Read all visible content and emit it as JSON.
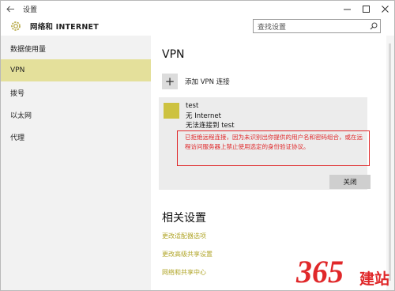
{
  "window": {
    "title": "设置"
  },
  "header": {
    "app_title": "网络和 INTERNET",
    "search_placeholder": "查找设置"
  },
  "sidebar": {
    "items": [
      {
        "label": "数据使用量"
      },
      {
        "label": "VPN"
      },
      {
        "label": "拨号"
      },
      {
        "label": "以太网"
      },
      {
        "label": "代理"
      }
    ],
    "active_index": 1
  },
  "main": {
    "heading": "VPN",
    "add_label": "添加 VPN 连接",
    "connection": {
      "name": "test",
      "status_line1": "无 Internet",
      "status_line2": "无法连接到 test",
      "error_message": "已拒绝远程连接，因为未识别出你提供的用户名和密码组合，或在远程访问服务器上禁止使用选定的身份验证协议。",
      "close_label": "关闭"
    },
    "related_heading": "相关设置",
    "related_links": [
      {
        "label": "更改适配器选项"
      },
      {
        "label": "更改高级共享设置"
      },
      {
        "label": "网络和共享中心"
      }
    ]
  },
  "watermark": {
    "text": "365建站"
  },
  "colors": {
    "accent": "#cdc240",
    "sidebar_active": "#e4e09b",
    "error": "#e0282a",
    "link": "#b1a62a",
    "watermark": "#e0282a"
  }
}
